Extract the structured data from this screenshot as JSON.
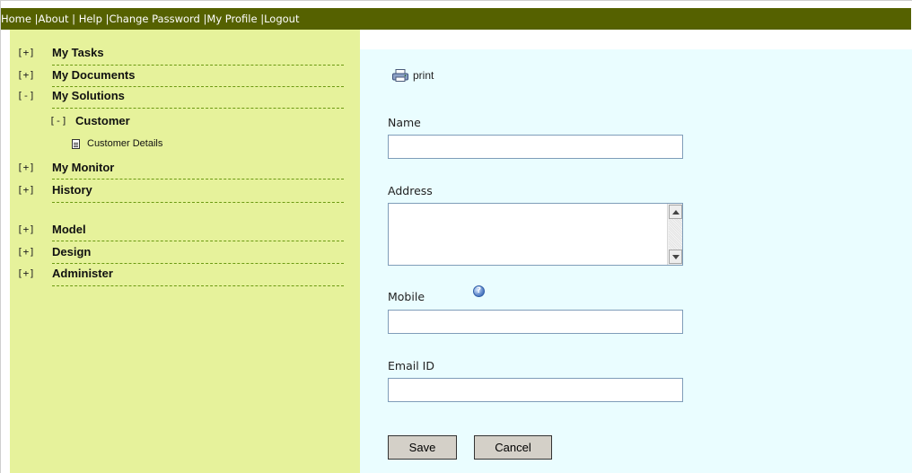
{
  "topnav": {
    "items": [
      "Home",
      "About",
      "Help",
      "Change Password",
      "My Profile",
      "Logout"
    ],
    "background": "#556100"
  },
  "sidebar": {
    "background": "#e6f29b",
    "items": [
      {
        "toggle": "[+]",
        "label": "My Tasks"
      },
      {
        "toggle": "[+]",
        "label": "My Documents"
      },
      {
        "toggle": "[-]",
        "label": "My Solutions"
      },
      {
        "toggle": "[-]",
        "label": "Customer"
      },
      {
        "label": "Customer Details"
      },
      {
        "toggle": "[+]",
        "label": "My Monitor"
      },
      {
        "toggle": "[+]",
        "label": "History"
      },
      {
        "toggle": "[+]",
        "label": "Model"
      },
      {
        "toggle": "[+]",
        "label": "Design"
      },
      {
        "toggle": "[+]",
        "label": "Administer"
      }
    ]
  },
  "main": {
    "background": "#eafdff",
    "print_label": "print",
    "fields": {
      "name": {
        "label": "Name",
        "value": ""
      },
      "address": {
        "label": "Address",
        "value": ""
      },
      "mobile": {
        "label": "Mobile",
        "value": "",
        "help": "?"
      },
      "email": {
        "label": "Email ID",
        "value": ""
      }
    },
    "save_label": "Save",
    "cancel_label": "Cancel"
  }
}
